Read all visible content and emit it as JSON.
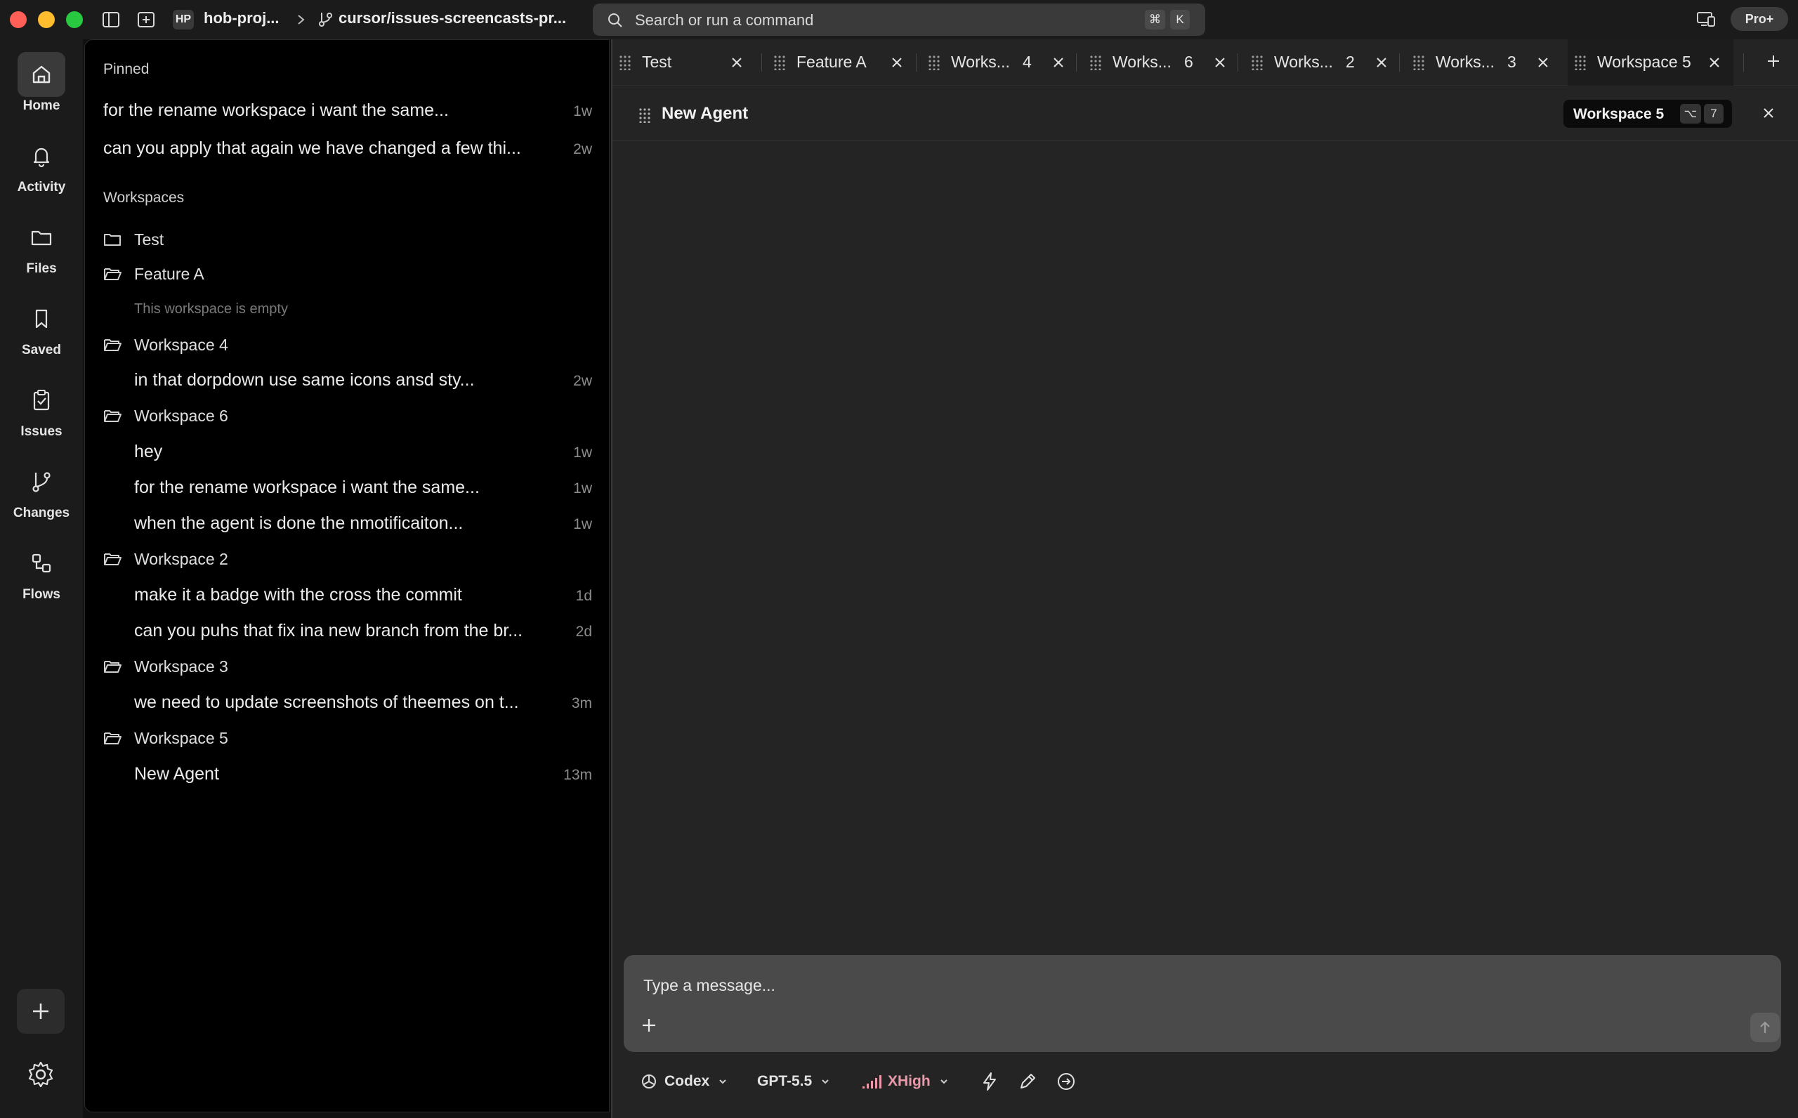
{
  "titlebar": {
    "project_badge": "HP",
    "project_name": "hob-proj...",
    "branch": "cursor/issues-screencasts-pr...",
    "search_placeholder": "Search or run a command",
    "shortcut_cmd": "⌘",
    "shortcut_key": "K",
    "plan_badge": "Pro+"
  },
  "rail": {
    "items": [
      {
        "label": "Home",
        "icon": "home-icon"
      },
      {
        "label": "Activity",
        "icon": "bell-icon"
      },
      {
        "label": "Files",
        "icon": "folder-icon"
      },
      {
        "label": "Saved",
        "icon": "bookmark-icon"
      },
      {
        "label": "Issues",
        "icon": "clipboard-check-icon"
      },
      {
        "label": "Changes",
        "icon": "git-branch-icon"
      },
      {
        "label": "Flows",
        "icon": "flows-icon"
      }
    ]
  },
  "sidebar": {
    "pinned_label": "Pinned",
    "pinned": [
      {
        "title": "for the rename workspace i want the same...",
        "age": "1w"
      },
      {
        "title": "can you apply that again we have changed a few thi...",
        "age": "2w"
      }
    ],
    "workspaces_label": "Workspaces",
    "workspaces": [
      {
        "name": "Test",
        "chats": []
      },
      {
        "name": "Feature A",
        "empty_note": "This workspace is empty",
        "chats": []
      },
      {
        "name": "Workspace 4",
        "chats": [
          {
            "title": "in that dorpdown use same icons ansd sty...",
            "age": "2w"
          }
        ]
      },
      {
        "name": "Workspace 6",
        "chats": [
          {
            "title": "hey",
            "age": "1w"
          },
          {
            "title": "for the rename workspace i want the same...",
            "age": "1w"
          },
          {
            "title": "when the agent is done the nmotificaiton...",
            "age": "1w"
          }
        ]
      },
      {
        "name": "Workspace 2",
        "chats": [
          {
            "title": "make it a badge with the cross the commit",
            "age": "1d"
          },
          {
            "title": "can you puhs that fix ina new branch from the br...",
            "age": "2d"
          }
        ]
      },
      {
        "name": "Workspace 3",
        "chats": [
          {
            "title": "we need to update screenshots of theemes on t...",
            "age": "3m"
          }
        ]
      },
      {
        "name": "Workspace 5",
        "chats": [
          {
            "title": "New Agent",
            "age": "13m"
          }
        ]
      }
    ]
  },
  "tabs": [
    {
      "label": "Test",
      "num": ""
    },
    {
      "label": "Feature A",
      "num": ""
    },
    {
      "label": "Works...",
      "num": "4"
    },
    {
      "label": "Works...",
      "num": "6"
    },
    {
      "label": "Works...",
      "num": "2"
    },
    {
      "label": "Works...",
      "num": "3"
    },
    {
      "label": "Workspace 5",
      "num": "",
      "active": true
    }
  ],
  "agent": {
    "title": "New Agent",
    "workspace_pill": "Workspace 5",
    "shortcut_mod": "⌥",
    "shortcut_num": "7"
  },
  "composer": {
    "placeholder": "Type a message..."
  },
  "toolbar": {
    "agent": "Codex",
    "model": "GPT-5.5",
    "effort": "XHigh"
  },
  "colors": {
    "accent_effort": "#e89aa8",
    "traffic_red": "#ff5f57",
    "traffic_yellow": "#febc2e",
    "traffic_green": "#28c840"
  }
}
